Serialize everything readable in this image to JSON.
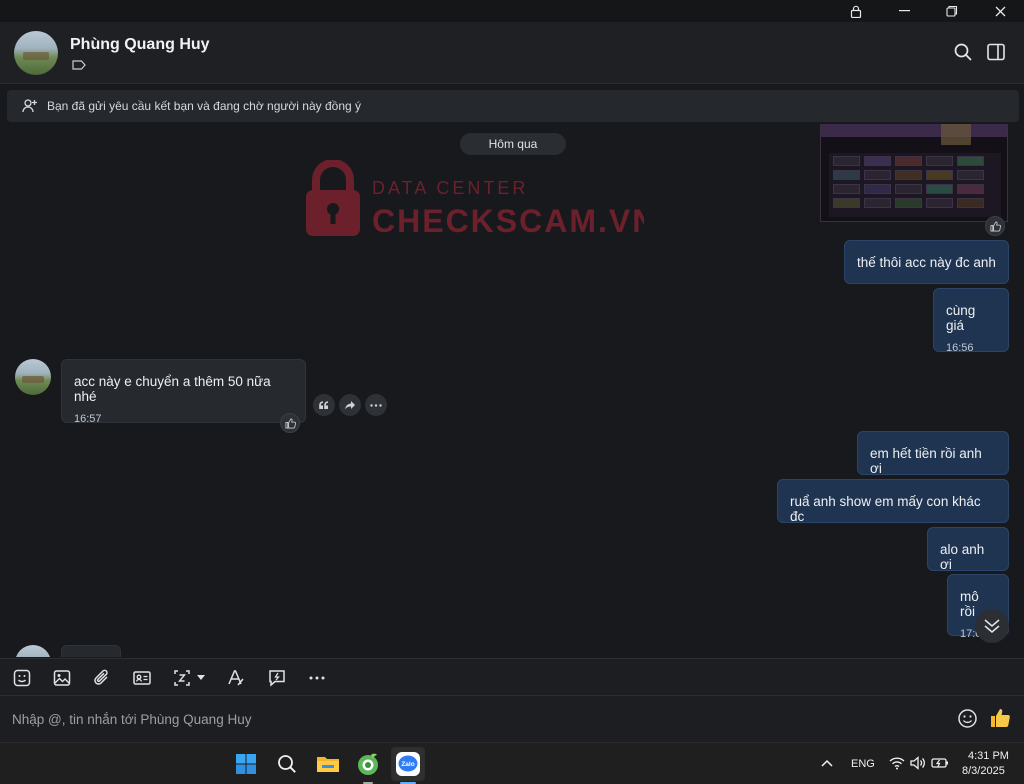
{
  "contact": {
    "name": "Phùng Quang Huy"
  },
  "notice": {
    "text": "Bạn đã gửi yêu cầu kết bạn và đang chờ người này đồng ý"
  },
  "chat": {
    "date_divider": "Hôm qua",
    "watermark": {
      "line1": "DATA CENTER",
      "line2": "CHECKSCAM.VN"
    },
    "messages": [
      {
        "dir": "out",
        "text": "thế thôi acc này đc anh"
      },
      {
        "dir": "out",
        "text": "cùng giá",
        "time": "16:56"
      },
      {
        "dir": "in",
        "text": "acc này e chuyển a thêm 50 nữa nhé",
        "time": "16:57"
      },
      {
        "dir": "out",
        "text": "em hết tiền rồi anh ơi"
      },
      {
        "dir": "out",
        "text": "ruẩ anh show em mấy con khác đc"
      },
      {
        "dir": "out",
        "text": "alo anh ơi"
      },
      {
        "dir": "out",
        "text": "mô rồi",
        "time": "17:0"
      }
    ]
  },
  "composer": {
    "placeholder": "Nhập @, tin nhắn tới Phùng Quang Huy"
  },
  "taskbar": {
    "language": "ENG",
    "time": "4:31 PM",
    "date": "8/3/2025",
    "zalo_label": "Zalo"
  },
  "colors": {
    "outgoing": "#1f3451",
    "incoming": "#26292e",
    "accent": "#2f7cf6",
    "watermark": "#b3263a"
  }
}
